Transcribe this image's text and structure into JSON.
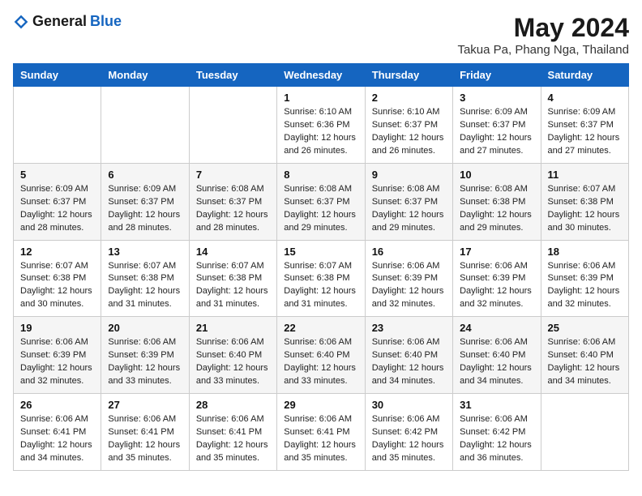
{
  "header": {
    "logo_general": "General",
    "logo_blue": "Blue",
    "month_title": "May 2024",
    "subtitle": "Takua Pa, Phang Nga, Thailand"
  },
  "weekdays": [
    "Sunday",
    "Monday",
    "Tuesday",
    "Wednesday",
    "Thursday",
    "Friday",
    "Saturday"
  ],
  "weeks": [
    [
      {
        "day": "",
        "sunrise": "",
        "sunset": "",
        "daylight": ""
      },
      {
        "day": "",
        "sunrise": "",
        "sunset": "",
        "daylight": ""
      },
      {
        "day": "",
        "sunrise": "",
        "sunset": "",
        "daylight": ""
      },
      {
        "day": "1",
        "sunrise": "Sunrise: 6:10 AM",
        "sunset": "Sunset: 6:36 PM",
        "daylight": "Daylight: 12 hours and 26 minutes."
      },
      {
        "day": "2",
        "sunrise": "Sunrise: 6:10 AM",
        "sunset": "Sunset: 6:37 PM",
        "daylight": "Daylight: 12 hours and 26 minutes."
      },
      {
        "day": "3",
        "sunrise": "Sunrise: 6:09 AM",
        "sunset": "Sunset: 6:37 PM",
        "daylight": "Daylight: 12 hours and 27 minutes."
      },
      {
        "day": "4",
        "sunrise": "Sunrise: 6:09 AM",
        "sunset": "Sunset: 6:37 PM",
        "daylight": "Daylight: 12 hours and 27 minutes."
      }
    ],
    [
      {
        "day": "5",
        "sunrise": "Sunrise: 6:09 AM",
        "sunset": "Sunset: 6:37 PM",
        "daylight": "Daylight: 12 hours and 28 minutes."
      },
      {
        "day": "6",
        "sunrise": "Sunrise: 6:09 AM",
        "sunset": "Sunset: 6:37 PM",
        "daylight": "Daylight: 12 hours and 28 minutes."
      },
      {
        "day": "7",
        "sunrise": "Sunrise: 6:08 AM",
        "sunset": "Sunset: 6:37 PM",
        "daylight": "Daylight: 12 hours and 28 minutes."
      },
      {
        "day": "8",
        "sunrise": "Sunrise: 6:08 AM",
        "sunset": "Sunset: 6:37 PM",
        "daylight": "Daylight: 12 hours and 29 minutes."
      },
      {
        "day": "9",
        "sunrise": "Sunrise: 6:08 AM",
        "sunset": "Sunset: 6:37 PM",
        "daylight": "Daylight: 12 hours and 29 minutes."
      },
      {
        "day": "10",
        "sunrise": "Sunrise: 6:08 AM",
        "sunset": "Sunset: 6:38 PM",
        "daylight": "Daylight: 12 hours and 29 minutes."
      },
      {
        "day": "11",
        "sunrise": "Sunrise: 6:07 AM",
        "sunset": "Sunset: 6:38 PM",
        "daylight": "Daylight: 12 hours and 30 minutes."
      }
    ],
    [
      {
        "day": "12",
        "sunrise": "Sunrise: 6:07 AM",
        "sunset": "Sunset: 6:38 PM",
        "daylight": "Daylight: 12 hours and 30 minutes."
      },
      {
        "day": "13",
        "sunrise": "Sunrise: 6:07 AM",
        "sunset": "Sunset: 6:38 PM",
        "daylight": "Daylight: 12 hours and 31 minutes."
      },
      {
        "day": "14",
        "sunrise": "Sunrise: 6:07 AM",
        "sunset": "Sunset: 6:38 PM",
        "daylight": "Daylight: 12 hours and 31 minutes."
      },
      {
        "day": "15",
        "sunrise": "Sunrise: 6:07 AM",
        "sunset": "Sunset: 6:38 PM",
        "daylight": "Daylight: 12 hours and 31 minutes."
      },
      {
        "day": "16",
        "sunrise": "Sunrise: 6:06 AM",
        "sunset": "Sunset: 6:39 PM",
        "daylight": "Daylight: 12 hours and 32 minutes."
      },
      {
        "day": "17",
        "sunrise": "Sunrise: 6:06 AM",
        "sunset": "Sunset: 6:39 PM",
        "daylight": "Daylight: 12 hours and 32 minutes."
      },
      {
        "day": "18",
        "sunrise": "Sunrise: 6:06 AM",
        "sunset": "Sunset: 6:39 PM",
        "daylight": "Daylight: 12 hours and 32 minutes."
      }
    ],
    [
      {
        "day": "19",
        "sunrise": "Sunrise: 6:06 AM",
        "sunset": "Sunset: 6:39 PM",
        "daylight": "Daylight: 12 hours and 32 minutes."
      },
      {
        "day": "20",
        "sunrise": "Sunrise: 6:06 AM",
        "sunset": "Sunset: 6:39 PM",
        "daylight": "Daylight: 12 hours and 33 minutes."
      },
      {
        "day": "21",
        "sunrise": "Sunrise: 6:06 AM",
        "sunset": "Sunset: 6:40 PM",
        "daylight": "Daylight: 12 hours and 33 minutes."
      },
      {
        "day": "22",
        "sunrise": "Sunrise: 6:06 AM",
        "sunset": "Sunset: 6:40 PM",
        "daylight": "Daylight: 12 hours and 33 minutes."
      },
      {
        "day": "23",
        "sunrise": "Sunrise: 6:06 AM",
        "sunset": "Sunset: 6:40 PM",
        "daylight": "Daylight: 12 hours and 34 minutes."
      },
      {
        "day": "24",
        "sunrise": "Sunrise: 6:06 AM",
        "sunset": "Sunset: 6:40 PM",
        "daylight": "Daylight: 12 hours and 34 minutes."
      },
      {
        "day": "25",
        "sunrise": "Sunrise: 6:06 AM",
        "sunset": "Sunset: 6:40 PM",
        "daylight": "Daylight: 12 hours and 34 minutes."
      }
    ],
    [
      {
        "day": "26",
        "sunrise": "Sunrise: 6:06 AM",
        "sunset": "Sunset: 6:41 PM",
        "daylight": "Daylight: 12 hours and 34 minutes."
      },
      {
        "day": "27",
        "sunrise": "Sunrise: 6:06 AM",
        "sunset": "Sunset: 6:41 PM",
        "daylight": "Daylight: 12 hours and 35 minutes."
      },
      {
        "day": "28",
        "sunrise": "Sunrise: 6:06 AM",
        "sunset": "Sunset: 6:41 PM",
        "daylight": "Daylight: 12 hours and 35 minutes."
      },
      {
        "day": "29",
        "sunrise": "Sunrise: 6:06 AM",
        "sunset": "Sunset: 6:41 PM",
        "daylight": "Daylight: 12 hours and 35 minutes."
      },
      {
        "day": "30",
        "sunrise": "Sunrise: 6:06 AM",
        "sunset": "Sunset: 6:42 PM",
        "daylight": "Daylight: 12 hours and 35 minutes."
      },
      {
        "day": "31",
        "sunrise": "Sunrise: 6:06 AM",
        "sunset": "Sunset: 6:42 PM",
        "daylight": "Daylight: 12 hours and 36 minutes."
      },
      {
        "day": "",
        "sunrise": "",
        "sunset": "",
        "daylight": ""
      }
    ]
  ]
}
